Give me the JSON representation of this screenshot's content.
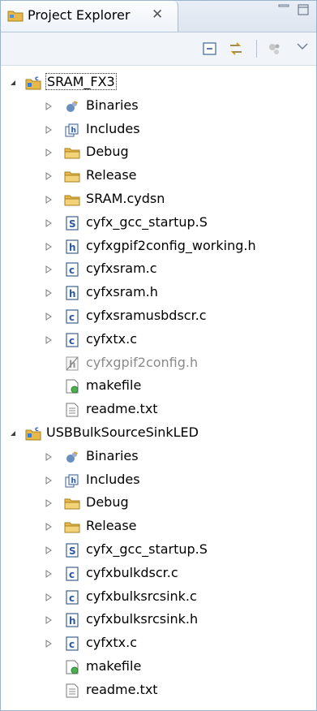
{
  "tab": {
    "title": "Project Explorer",
    "close_glyph": "✕"
  },
  "colors": {
    "folder": "#e8b84a",
    "project": "#e8b84a",
    "file_border": "#3b5f8f",
    "twisty": "#7a7a7a"
  },
  "tree": [
    {
      "label": "SRAM_FX3",
      "kind": "project",
      "depth": 0,
      "expanded": true,
      "selected": true
    },
    {
      "label": "Binaries",
      "kind": "binaries",
      "depth": 1,
      "expandable": true
    },
    {
      "label": "Includes",
      "kind": "includes",
      "depth": 1,
      "expandable": true
    },
    {
      "label": "Debug",
      "kind": "folder",
      "depth": 1,
      "expandable": true
    },
    {
      "label": "Release",
      "kind": "folder",
      "depth": 1,
      "expandable": true
    },
    {
      "label": "SRAM.cydsn",
      "kind": "folder",
      "depth": 1,
      "expandable": true
    },
    {
      "label": "cyfx_gcc_startup.S",
      "kind": "file-s",
      "depth": 1,
      "expandable": true
    },
    {
      "label": "cyfxgpif2config_working.h",
      "kind": "file-h",
      "depth": 1,
      "expandable": true
    },
    {
      "label": "cyfxsram.c",
      "kind": "file-c",
      "depth": 1,
      "expandable": true
    },
    {
      "label": "cyfxsram.h",
      "kind": "file-h",
      "depth": 1,
      "expandable": true
    },
    {
      "label": "cyfxsramusbdscr.c",
      "kind": "file-c",
      "depth": 1,
      "expandable": true
    },
    {
      "label": "cyfxtx.c",
      "kind": "file-c",
      "depth": 1,
      "expandable": true
    },
    {
      "label": "cyfxgpif2config.h",
      "kind": "file-excluded",
      "depth": 1,
      "expandable": false,
      "disabled": true
    },
    {
      "label": "makefile",
      "kind": "makefile",
      "depth": 1,
      "expandable": false
    },
    {
      "label": "readme.txt",
      "kind": "text",
      "depth": 1,
      "expandable": false
    },
    {
      "label": "USBBulkSourceSinkLED",
      "kind": "project",
      "depth": 0,
      "expanded": true
    },
    {
      "label": "Binaries",
      "kind": "binaries",
      "depth": 1,
      "expandable": true
    },
    {
      "label": "Includes",
      "kind": "includes",
      "depth": 1,
      "expandable": true
    },
    {
      "label": "Debug",
      "kind": "folder",
      "depth": 1,
      "expandable": true
    },
    {
      "label": "Release",
      "kind": "folder",
      "depth": 1,
      "expandable": true
    },
    {
      "label": "cyfx_gcc_startup.S",
      "kind": "file-s",
      "depth": 1,
      "expandable": true
    },
    {
      "label": "cyfxbulkdscr.c",
      "kind": "file-c",
      "depth": 1,
      "expandable": true
    },
    {
      "label": "cyfxbulksrcsink.c",
      "kind": "file-c",
      "depth": 1,
      "expandable": true
    },
    {
      "label": "cyfxbulksrcsink.h",
      "kind": "file-h",
      "depth": 1,
      "expandable": true
    },
    {
      "label": "cyfxtx.c",
      "kind": "file-c",
      "depth": 1,
      "expandable": true
    },
    {
      "label": "makefile",
      "kind": "makefile",
      "depth": 1,
      "expandable": false
    },
    {
      "label": "readme.txt",
      "kind": "text",
      "depth": 1,
      "expandable": false
    }
  ]
}
